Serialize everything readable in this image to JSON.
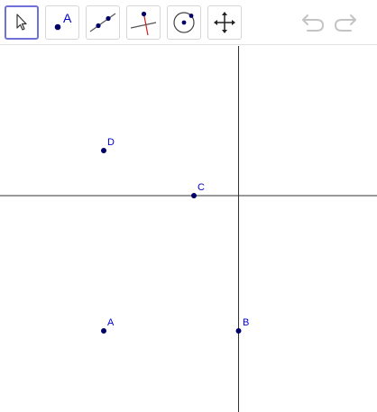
{
  "colors": {
    "point": "#000066",
    "label": "#0000cc",
    "axis": "#333333",
    "selected": "#6f71d6"
  },
  "toolbar": {
    "tools": [
      {
        "icon": "move-cursor-icon",
        "selected": true
      },
      {
        "icon": "point-icon",
        "text": "A"
      },
      {
        "icon": "line-icon"
      },
      {
        "icon": "perpendicular-line-icon"
      },
      {
        "icon": "circle-icon"
      },
      {
        "icon": "move-graphics-icon"
      }
    ],
    "undo_icon": "undo-icon",
    "redo_icon": "redo-icon"
  },
  "points": [
    {
      "label": "D"
    },
    {
      "label": "C"
    },
    {
      "label": "A"
    },
    {
      "label": "B"
    }
  ]
}
